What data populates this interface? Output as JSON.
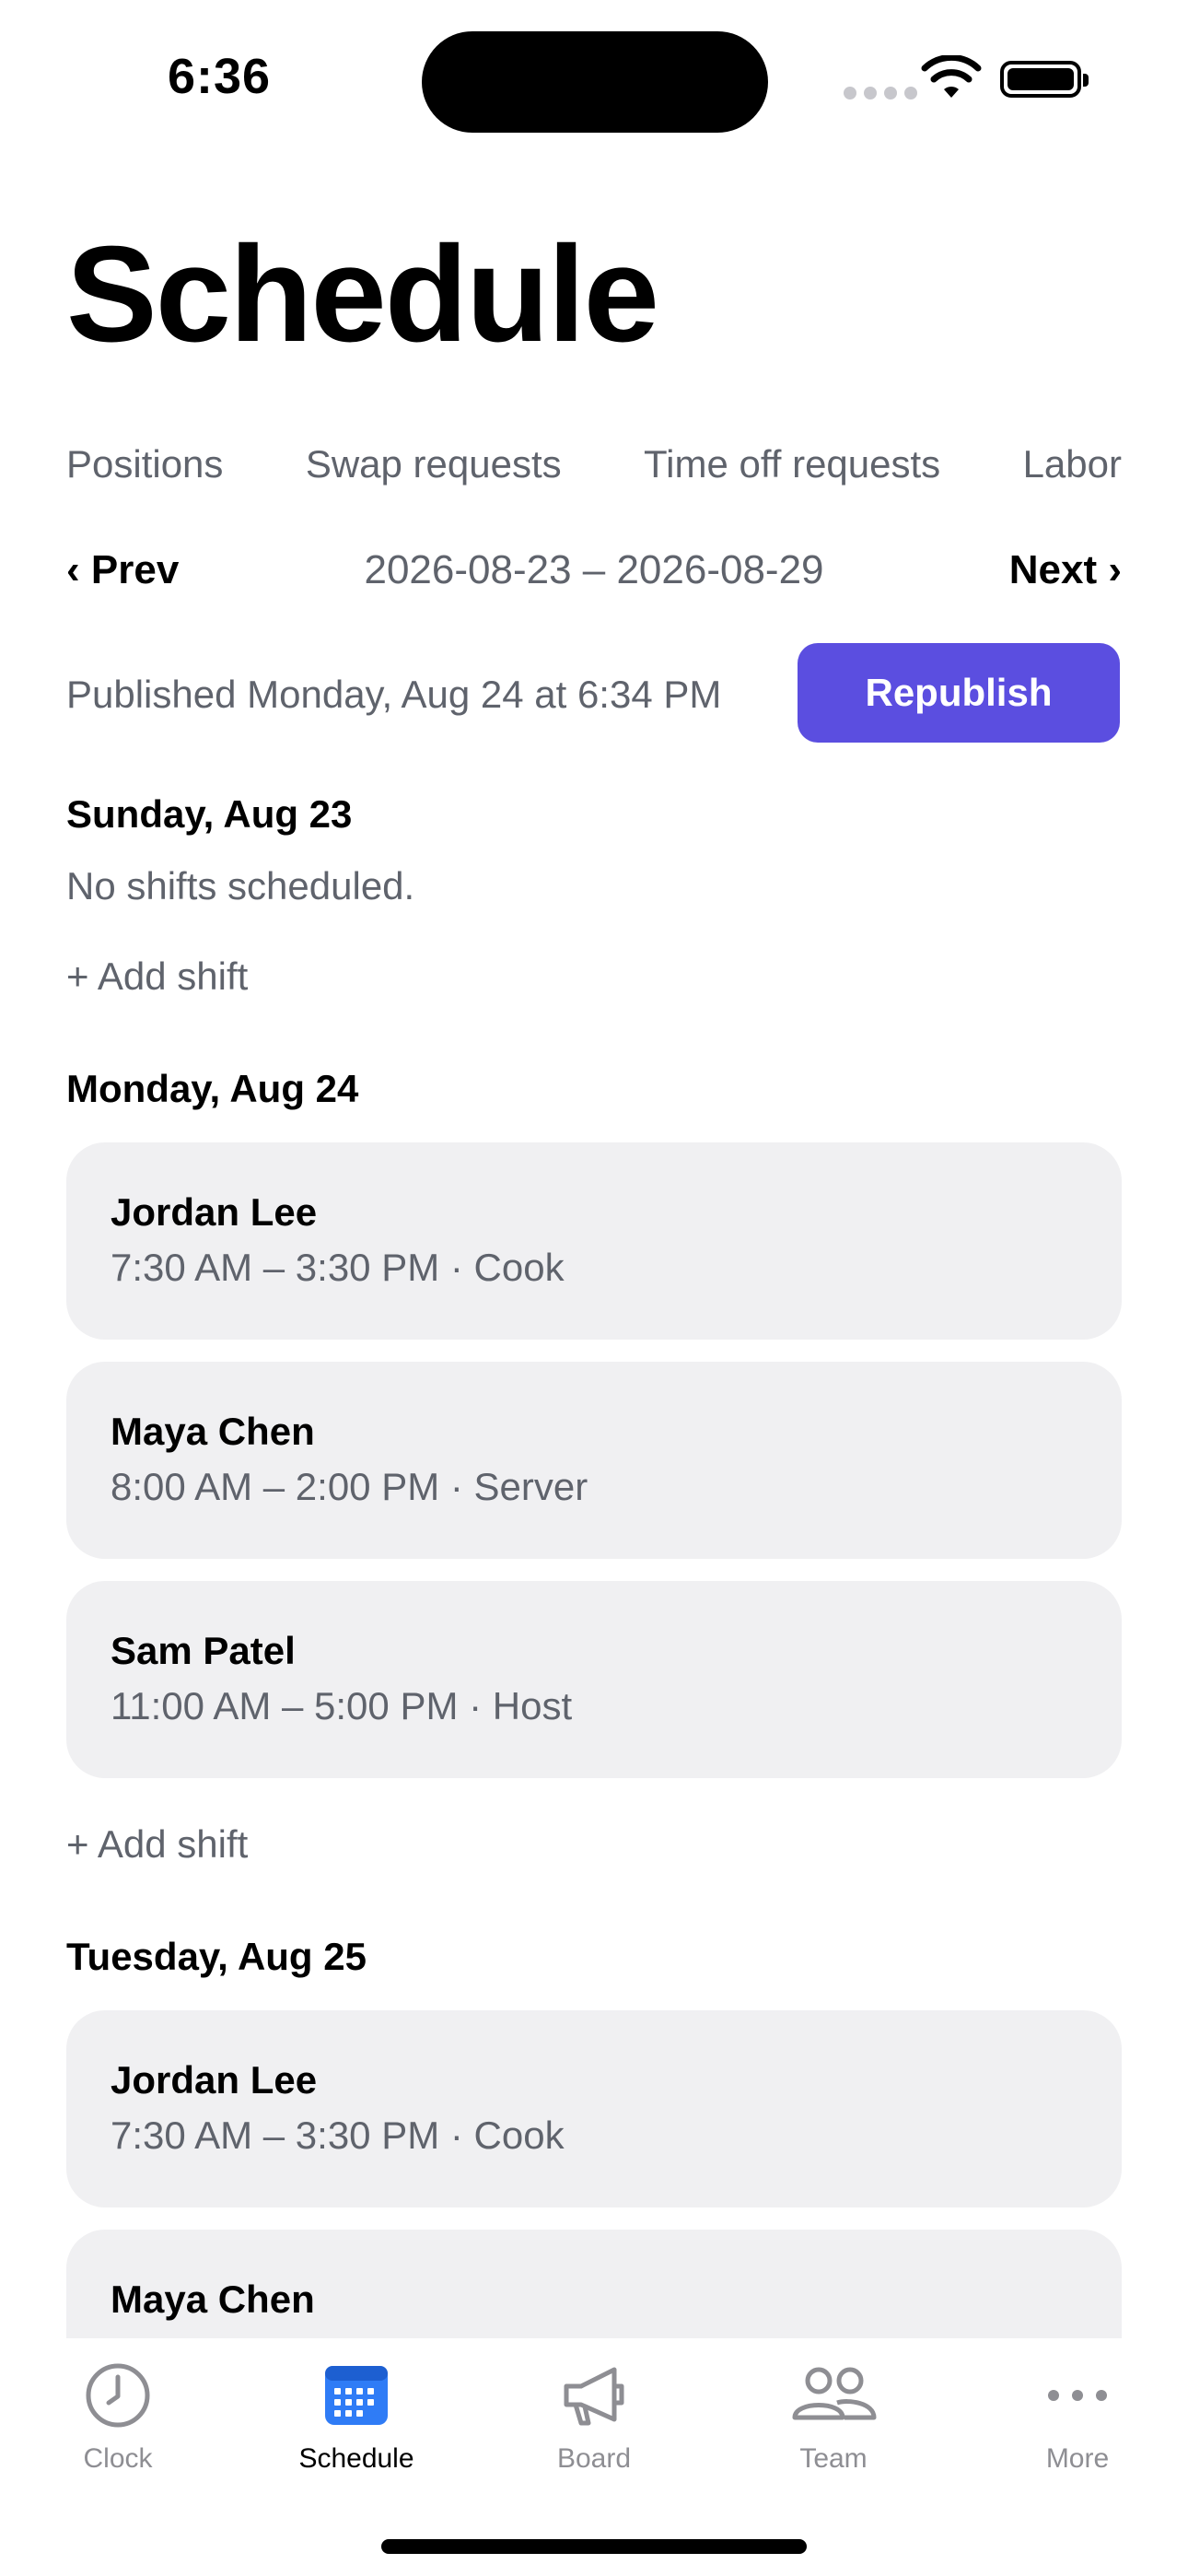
{
  "status_bar": {
    "time": "6:36"
  },
  "page": {
    "title": "Schedule"
  },
  "sub_nav": [
    {
      "label": "Positions"
    },
    {
      "label": "Swap requests"
    },
    {
      "label": "Time off requests"
    },
    {
      "label": "Labor"
    }
  ],
  "week": {
    "prev": "‹ Prev",
    "range": "2026-08-23 – 2026-08-29",
    "next": "Next ›"
  },
  "publish": {
    "status": "Published Monday, Aug 24 at 6:34 PM",
    "button": "Republish"
  },
  "colors": {
    "accent": "#5b4ee0",
    "card": "#f0f0f2",
    "muted": "#5f636c"
  },
  "days": [
    {
      "heading": "Sunday, Aug 23",
      "empty": "No shifts scheduled.",
      "add": "+ Add shift",
      "shifts": []
    },
    {
      "heading": "Monday, Aug 24",
      "add": "+ Add shift",
      "shifts": [
        {
          "name": "Jordan Lee",
          "detail": "7:30 AM – 3:30 PM · Cook"
        },
        {
          "name": "Maya Chen",
          "detail": "8:00 AM – 2:00 PM · Server"
        },
        {
          "name": "Sam Patel",
          "detail": "11:00 AM – 5:00 PM · Host"
        }
      ]
    },
    {
      "heading": "Tuesday, Aug 25",
      "shifts": [
        {
          "name": "Jordan Lee",
          "detail": "7:30 AM – 3:30 PM · Cook"
        },
        {
          "name": "Maya Chen"
        }
      ]
    }
  ],
  "tabs": [
    {
      "label": "Clock",
      "icon": "clock-icon"
    },
    {
      "label": "Schedule",
      "icon": "calendar-icon",
      "active": true
    },
    {
      "label": "Board",
      "icon": "megaphone-icon"
    },
    {
      "label": "Team",
      "icon": "people-icon"
    },
    {
      "label": "More",
      "icon": "ellipsis-icon"
    }
  ]
}
